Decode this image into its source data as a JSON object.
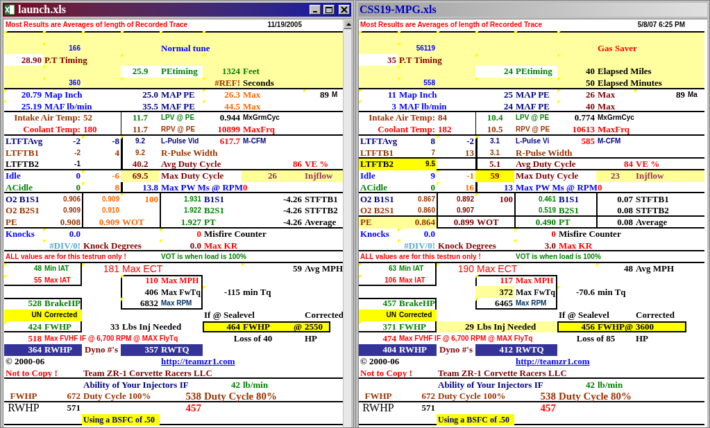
{
  "windows": [
    {
      "title": "launch.xls",
      "active": true,
      "cells": [
        {
          "text": "Most Results are Averages of length of Recorded Trace",
          "color": "#ff0000"
        },
        {
          "text": "11/19/2005",
          "color": "#000000"
        },
        {
          "text": "166",
          "color": "#0000ff"
        },
        {
          "text": "Normal tune",
          "color": "#0000ff"
        },
        {
          "text": "28.90",
          "color": "#800000"
        },
        {
          "text": "P.T Timing",
          "color": "#800000"
        },
        {
          "text": "25.9",
          "color": "#008000"
        },
        {
          "text": "PEtiming",
          "color": "#008000"
        },
        {
          "text": "1324",
          "color": "#008000"
        },
        {
          "text": "Feet",
          "color": "#008000"
        },
        {
          "text": "360",
          "color": "#0000ff"
        },
        {
          "text": "#REF!",
          "color": "#993300"
        },
        {
          "text": "Seconds",
          "color": "#000000"
        },
        {
          "text": "20.79",
          "color": "#0000ff"
        },
        {
          "text": "Map Inch",
          "color": "#0000ff"
        },
        {
          "text": "25.0",
          "color": "#000080"
        },
        {
          "text": "MAP PE",
          "color": "#000080"
        },
        {
          "text": "26.3",
          "color": "#ff6600"
        },
        {
          "text": "Max",
          "color": "#ff6600"
        },
        {
          "text": "89",
          "color": "#000000"
        },
        {
          "text": "M",
          "color": "#000000"
        },
        {
          "text": "25.19",
          "color": "#0000ff"
        },
        {
          "text": "MAF lb/min",
          "color": "#0000ff"
        },
        {
          "text": "35.5",
          "color": "#000080"
        },
        {
          "text": "MAF PE",
          "color": "#000080"
        },
        {
          "text": "44.5",
          "color": "#ff6600"
        },
        {
          "text": "Max",
          "color": "#ff6600"
        },
        {
          "text": "Intake Air Temp:",
          "color": "#993300"
        },
        {
          "text": "52",
          "color": "#993300"
        },
        {
          "text": "11.7",
          "color": "#008000"
        },
        {
          "text": "LPV @ PE",
          "color": "#008000"
        },
        {
          "text": "0.944",
          "color": "#000000"
        },
        {
          "text": "MxGrmCyc",
          "color": "#000000"
        },
        {
          "text": "Coolant Temp:",
          "color": "#ff0000"
        },
        {
          "text": "180",
          "color": "#ff0000"
        },
        {
          "text": "11.7",
          "color": "#993300"
        },
        {
          "text": "RPV @ PE",
          "color": "#993300"
        },
        {
          "text": "10899",
          "color": "#ff0000"
        },
        {
          "text": "MaxFrq",
          "color": "#ff0000"
        },
        {
          "text": "LTFTAvg",
          "color": "#000080"
        },
        {
          "text": "-2",
          "color": "#000080"
        },
        {
          "text": "-8",
          "color": "#000080"
        },
        {
          "text": "9.2",
          "color": "#000080"
        },
        {
          "text": "L-Pulse Vid",
          "color": "#000080"
        },
        {
          "text": "617.7",
          "color": "#ff0000"
        },
        {
          "text": "M-CFM",
          "color": "#000080"
        },
        {
          "text": "LTFTB1",
          "color": "#993300"
        },
        {
          "text": "-2",
          "color": "#993300"
        },
        {
          "text": "4",
          "color": "#993300"
        },
        {
          "text": "9.2",
          "color": "#993300"
        },
        {
          "text": "R-Pulse Width",
          "color": "#993300"
        },
        {
          "text": "LTFTB2",
          "color": "#000000"
        },
        {
          "text": "-1",
          "color": "#000000"
        },
        {
          "text": "40.2",
          "color": "#800000"
        },
        {
          "text": "Avg Duty Cycle",
          "color": "#800000"
        },
        {
          "text": "86",
          "color": "#ff0000"
        },
        {
          "text": "VE %",
          "color": "#ff0000"
        },
        {
          "text": "Idle",
          "color": "#0000ff"
        },
        {
          "text": "0",
          "color": "#0000ff"
        },
        {
          "text": "-6",
          "color": "#ff6600"
        },
        {
          "text": "69.5",
          "color": "#ffff99",
          "highlighted": true
        },
        {
          "text": "Max Duty Cycle",
          "color": "#800000"
        },
        {
          "text": "26",
          "color": "#ffff99",
          "highlighted": true
        },
        {
          "text": "Injflow",
          "color": "#ffff99",
          "highlighted": true
        },
        {
          "text": "ACidle",
          "color": "#008000"
        },
        {
          "text": "0",
          "color": "#008000"
        },
        {
          "text": "8",
          "color": "#ff6600"
        },
        {
          "text": "13.8",
          "color": "#0000ff"
        },
        {
          "text": "Max PW Ms @ RPM",
          "color": "#0000ff"
        },
        {
          "text": "0",
          "color": "#ff0000"
        },
        {
          "text": "O2 B1S1",
          "color": "#000080"
        },
        {
          "text": "0.906",
          "color": "#993300"
        },
        {
          "text": "0.909",
          "color": "#ff6600"
        },
        {
          "text": "100",
          "color": "#ff6600"
        },
        {
          "text": "1.931",
          "color": "#008000"
        },
        {
          "text": "B1S1",
          "color": "#000080"
        },
        {
          "text": "-4.26",
          "color": "#000000"
        },
        {
          "text": "STFTB1",
          "color": "#000000"
        },
        {
          "text": "O2 B2S1",
          "color": "#993300"
        },
        {
          "text": "0.909",
          "color": "#993300"
        },
        {
          "text": "0.910",
          "color": "#ff6600"
        },
        {
          "text": "1.922",
          "color": "#008000"
        },
        {
          "text": "B2S1",
          "color": "#008000"
        },
        {
          "text": "-4.26",
          "color": "#000000"
        },
        {
          "text": "STFTB2",
          "color": "#000000"
        },
        {
          "text": "PE",
          "color": "#993300"
        },
        {
          "text": "0.908",
          "color": "#993300"
        },
        {
          "text": "0.909",
          "color": "#ff6600"
        },
        {
          "text": "WOT",
          "color": "#ff6600"
        },
        {
          "text": "1.927",
          "color": "#008000"
        },
        {
          "text": "PT",
          "color": "#008000"
        },
        {
          "text": "-4.26",
          "color": "#000000"
        },
        {
          "text": "Average",
          "color": "#000000"
        },
        {
          "text": "Knocks",
          "color": "#0000ff"
        },
        {
          "text": "0.0",
          "color": "#0000ff"
        },
        {
          "text": "0",
          "color": "#ff0000"
        },
        {
          "text": "Misfire Counter",
          "color": "#000000"
        },
        {
          "text": "#DIV/0!",
          "color": "#5aa9cc"
        },
        {
          "text": "Knock  Degrees",
          "color": "#800000"
        },
        {
          "text": "0.0",
          "color": "#800000"
        },
        {
          "text": "Max KR",
          "color": "#ff0000"
        },
        {
          "text": "ALL values are for this testrun only !",
          "color": "#ff0000"
        },
        {
          "text": "VOT is when load is 100%",
          "color": "#008000"
        },
        {
          "text": "48",
          "color": "#008000"
        },
        {
          "text": "Min IAT",
          "color": "#008000"
        },
        {
          "text": "181",
          "color": "#ff0000"
        },
        {
          "text": "Max ECT",
          "color": "#ff0000"
        },
        {
          "text": "59",
          "color": "#000000"
        },
        {
          "text": "Avg MPH",
          "color": "#000000"
        },
        {
          "text": "55",
          "color": "#ff0000"
        },
        {
          "text": "Max IAT",
          "color": "#ff0000"
        },
        {
          "text": "110",
          "color": "#ff0000"
        },
        {
          "text": "Max MPH",
          "color": "#ff0000"
        },
        {
          "text": "406",
          "color": "#000000"
        },
        {
          "text": "Max FwTq",
          "color": "#000000"
        },
        {
          "text": "-115",
          "color": "#000000"
        },
        {
          "text": "min Tq",
          "color": "#000000"
        },
        {
          "text": "528",
          "color": "#008000"
        },
        {
          "text": "BrakeHP",
          "color": "#008000"
        },
        {
          "text": "6832",
          "color": "#000000"
        },
        {
          "text": "Max RPM",
          "color": "#003366"
        },
        {
          "text": "UN",
          "color": "#ffff00",
          "highlighted": true
        },
        {
          "text": "Corrected",
          "color": "#ffff00",
          "highlighted": true
        },
        {
          "text": "If @ Sealevel",
          "color": "#000000"
        },
        {
          "text": "Corrected",
          "color": "#000000"
        },
        {
          "text": "424",
          "color": "#008000"
        },
        {
          "text": "FWHP",
          "color": "#008000"
        },
        {
          "text": "33",
          "color": "#000000"
        },
        {
          "text": "Lbs Inj Needed",
          "color": "#000000"
        },
        {
          "text": "464",
          "color": "#000000"
        },
        {
          "text": "FWHP",
          "color": "#000000"
        },
        {
          "text": "@",
          "color": "#000000"
        },
        {
          "text": "2550",
          "color": "#000000"
        },
        {
          "text": "518",
          "color": "#ff0000"
        },
        {
          "text": "Max FVHF IF @ 6,700 RPM @ MAX FlyTq",
          "color": "#ff0000"
        },
        {
          "text": "Loss of 40",
          "color": "#000000"
        },
        {
          "text": "HP",
          "color": "#000000"
        },
        {
          "text": "364",
          "color": "#333399",
          "highlighted": true
        },
        {
          "text": "RWHP",
          "color": "#333399",
          "highlighted": true
        },
        {
          "text": "Dyno #'s",
          "color": "#800000"
        },
        {
          "text": "357",
          "color": "#333399",
          "highlighted": true
        },
        {
          "text": "RWTQ",
          "color": "#333399",
          "highlighted": true
        },
        {
          "text": "© 2000-06",
          "color": "#000000"
        },
        {
          "text": "http://teamzr1.com",
          "color": "#0000ff"
        },
        {
          "text": "Not to Copy !",
          "color": "#ff0000"
        },
        {
          "text": "Team ZR-1 Corvette Racers LLC",
          "color": "#800000"
        },
        {
          "text": "Ability of Your Injectors IF",
          "color": "#000080"
        },
        {
          "text": "42",
          "color": "#008000"
        },
        {
          "text": "lb/min",
          "color": "#008000"
        },
        {
          "text": "FWHP",
          "color": "#993300"
        },
        {
          "text": "672",
          "color": "#993300"
        },
        {
          "text": "Duty Cycle 100%",
          "color": "#993300"
        },
        {
          "text": "538",
          "color": "#993300"
        },
        {
          "text": "Duty Cycle 80%",
          "color": "#993300"
        },
        {
          "text": "RWHP",
          "color": "#000000"
        },
        {
          "text": "571",
          "color": "#000000"
        },
        {
          "text": "457",
          "color": "#ff0000"
        },
        {
          "text": "Using a BSFC of .50",
          "color": "#ffff00",
          "highlighted": true
        }
      ]
    },
    {
      "title": "CSS19-MPG.xls",
      "active": false,
      "cells": [
        {
          "text": "Most Results are Averages of length of Recorded Trace",
          "color": "#ff0000"
        },
        {
          "text": "5/8/07 6:25 PM",
          "color": "#000000"
        },
        {
          "text": "56119",
          "color": "#0000ff"
        },
        {
          "text": "Gas Saver",
          "color": "#ff0000"
        },
        {
          "text": "35",
          "color": "#800000"
        },
        {
          "text": "P.T Timing",
          "color": "#800000"
        },
        {
          "text": "24",
          "color": "#008000"
        },
        {
          "text": "PEtiming",
          "color": "#008000"
        },
        {
          "text": "40",
          "color": "#000000"
        },
        {
          "text": "Elapsed Miles",
          "color": "#000000"
        },
        {
          "text": "558",
          "color": "#0000ff"
        },
        {
          "text": "50",
          "color": "#000000"
        },
        {
          "text": "Elapsed Minutes",
          "color": "#000000"
        },
        {
          "text": "11",
          "color": "#0000ff"
        },
        {
          "text": "Map Inch",
          "color": "#0000ff"
        },
        {
          "text": "25",
          "color": "#000080"
        },
        {
          "text": "MAP PE",
          "color": "#000080"
        },
        {
          "text": "26",
          "color": "#800000"
        },
        {
          "text": "Max",
          "color": "#800000"
        },
        {
          "text": "89",
          "color": "#000000"
        },
        {
          "text": "Ma",
          "color": "#000000"
        },
        {
          "text": "3",
          "color": "#0000ff"
        },
        {
          "text": "MAF lb/min",
          "color": "#0000ff"
        },
        {
          "text": "24",
          "color": "#000080"
        },
        {
          "text": "MAF PE",
          "color": "#000080"
        },
        {
          "text": "40",
          "color": "#800000"
        },
        {
          "text": "Max",
          "color": "#800000"
        },
        {
          "text": "Intake Air Temp:",
          "color": "#993300"
        },
        {
          "text": "84",
          "color": "#993300"
        },
        {
          "text": "10.4",
          "color": "#008000"
        },
        {
          "text": "LPV @ PE",
          "color": "#008000"
        },
        {
          "text": "0.774",
          "color": "#000000"
        },
        {
          "text": "MxGrmCyc",
          "color": "#000000"
        },
        {
          "text": "Coolant Temp:",
          "color": "#ff0000"
        },
        {
          "text": "182",
          "color": "#ff0000"
        },
        {
          "text": "10.5",
          "color": "#993300"
        },
        {
          "text": "RPV @ PE",
          "color": "#993300"
        },
        {
          "text": "10613",
          "color": "#ff0000"
        },
        {
          "text": "MaxFrq",
          "color": "#ff0000"
        },
        {
          "text": "LTFTAvg",
          "color": "#000080"
        },
        {
          "text": "8",
          "color": "#000080"
        },
        {
          "text": "-2",
          "color": "#000080"
        },
        {
          "text": "3.1",
          "color": "#000080"
        },
        {
          "text": "L-Pulse Vi",
          "color": "#000080"
        },
        {
          "text": "585",
          "color": "#ff0000"
        },
        {
          "text": "M-CFM",
          "color": "#000080"
        },
        {
          "text": "LTFTB1",
          "color": "#993300"
        },
        {
          "text": "7",
          "color": "#993300"
        },
        {
          "text": "13",
          "color": "#993300"
        },
        {
          "text": "3.1",
          "color": "#993300"
        },
        {
          "text": "R-Pulse Width",
          "color": "#993300"
        },
        {
          "text": "LTFTB2",
          "color": "#ffff00",
          "highlighted": true
        },
        {
          "text": "9.5",
          "color": "#ffff00",
          "highlighted": true
        },
        {
          "text": "5.1",
          "color": "#800000"
        },
        {
          "text": "Avg Duty Cycle",
          "color": "#800000"
        },
        {
          "text": "84",
          "color": "#ff0000"
        },
        {
          "text": "VE %",
          "color": "#ff0000"
        },
        {
          "text": "Idle",
          "color": "#0000ff"
        },
        {
          "text": "9",
          "color": "#0000ff"
        },
        {
          "text": "-1",
          "color": "#ff6600"
        },
        {
          "text": "59",
          "color": "#ffff00",
          "highlighted": true
        },
        {
          "text": "Max Duty Cycle",
          "color": "#800000"
        },
        {
          "text": "23",
          "color": "#ffff99",
          "highlighted": true
        },
        {
          "text": "Injflow",
          "color": "#ffff99",
          "highlighted": true
        },
        {
          "text": "ACidle",
          "color": "#008000"
        },
        {
          "text": "0",
          "color": "#008000"
        },
        {
          "text": "16",
          "color": "#ff6600"
        },
        {
          "text": "13",
          "color": "#0000ff"
        },
        {
          "text": "Max PW Ms @ RPM",
          "color": "#0000ff"
        },
        {
          "text": "0",
          "color": "#ff0000"
        },
        {
          "text": "O2 B1S1",
          "color": "#000080"
        },
        {
          "text": "0.867",
          "color": "#993300"
        },
        {
          "text": "0.892",
          "color": "#800000"
        },
        {
          "text": "100",
          "color": "#800000"
        },
        {
          "text": "0.461",
          "color": "#008000"
        },
        {
          "text": "B1S1",
          "color": "#000080"
        },
        {
          "text": "0.07",
          "color": "#000000"
        },
        {
          "text": "STFTB1",
          "color": "#000000"
        },
        {
          "text": "O2 B2S1",
          "color": "#993300"
        },
        {
          "text": "0.860",
          "color": "#993300"
        },
        {
          "text": "0.907",
          "color": "#800000"
        },
        {
          "text": "0.519",
          "color": "#008000"
        },
        {
          "text": "B2S1",
          "color": "#008000"
        },
        {
          "text": "0.08",
          "color": "#000000"
        },
        {
          "text": "STFTB2",
          "color": "#000000"
        },
        {
          "text": "PE",
          "color": "#ffff99",
          "highlighted": true
        },
        {
          "text": "0.864",
          "color": "#ffff99",
          "highlighted": true
        },
        {
          "text": "0.899",
          "color": "#800000"
        },
        {
          "text": "WOT",
          "color": "#800000"
        },
        {
          "text": "0.490",
          "color": "#008000"
        },
        {
          "text": "PT",
          "color": "#008000"
        },
        {
          "text": "0.08",
          "color": "#000000"
        },
        {
          "text": "Average",
          "color": "#000000"
        },
        {
          "text": "Knocks",
          "color": "#0000ff"
        },
        {
          "text": "0.0",
          "color": "#0000ff"
        },
        {
          "text": "0",
          "color": "#ff0000"
        },
        {
          "text": "Misfire Counter",
          "color": "#000000"
        },
        {
          "text": "#DIV/0!",
          "color": "#5aa9cc"
        },
        {
          "text": "Knock  Degrees",
          "color": "#800000"
        },
        {
          "text": "3.0",
          "color": "#800000"
        },
        {
          "text": "Max KR",
          "color": "#ff0000"
        },
        {
          "text": "ALL values are for this testrun only !",
          "color": "#ff0000"
        },
        {
          "text": "VOT is when load is 100%",
          "color": "#008000"
        },
        {
          "text": "63",
          "color": "#008000"
        },
        {
          "text": "Min IAT",
          "color": "#008000"
        },
        {
          "text": "190",
          "color": "#ff0000"
        },
        {
          "text": "Max ECT",
          "color": "#ff0000"
        },
        {
          "text": "48",
          "color": "#000000"
        },
        {
          "text": "Avg MPH",
          "color": "#000000"
        },
        {
          "text": "106",
          "color": "#ff0000"
        },
        {
          "text": "Max IAT",
          "color": "#ff0000"
        },
        {
          "text": "117",
          "color": "#ff0000"
        },
        {
          "text": "Max MPH",
          "color": "#ff0000"
        },
        {
          "text": "372",
          "color": "#ffff99",
          "highlighted": true
        },
        {
          "text": "Max FwTq",
          "color": "#000000"
        },
        {
          "text": "-70.6",
          "color": "#000000"
        },
        {
          "text": "min Tq",
          "color": "#000000"
        },
        {
          "text": "457",
          "color": "#008000"
        },
        {
          "text": "BrakeHP",
          "color": "#008000"
        },
        {
          "text": "6465",
          "color": "#000000"
        },
        {
          "text": "Max RPM",
          "color": "#003366"
        },
        {
          "text": "UN",
          "color": "#ffff00",
          "highlighted": true
        },
        {
          "text": "Corrected",
          "color": "#ffff00",
          "highlighted": true
        },
        {
          "text": "If @ Sealevel",
          "color": "#000000"
        },
        {
          "text": "Corrected",
          "color": "#000000"
        },
        {
          "text": "371",
          "color": "#008000"
        },
        {
          "text": "FWHP",
          "color": "#008000"
        },
        {
          "text": "29",
          "color": "#ffff99",
          "highlighted": true
        },
        {
          "text": "Lbs Inj Needed",
          "color": "#ffff99",
          "highlighted": true
        },
        {
          "text": "456",
          "color": "#000000"
        },
        {
          "text": "FWHP",
          "color": "#000000"
        },
        {
          "text": "@",
          "color": "#000000"
        },
        {
          "text": "3600",
          "color": "#000000"
        },
        {
          "text": "474",
          "color": "#ff0000"
        },
        {
          "text": "Max FVHF IF @ 6,700 RPM @ MAX FlyTq",
          "color": "#ff0000"
        },
        {
          "text": "Loss of 85",
          "color": "#000000"
        },
        {
          "text": "HP",
          "color": "#000000"
        },
        {
          "text": "404",
          "color": "#333399",
          "highlighted": true
        },
        {
          "text": "RWHP",
          "color": "#333399",
          "highlighted": true
        },
        {
          "text": "Dyno #'s",
          "color": "#800000"
        },
        {
          "text": "412",
          "color": "#333399",
          "highlighted": true
        },
        {
          "text": "RWTQ",
          "color": "#333399",
          "highlighted": true
        },
        {
          "text": "© 2000-06",
          "color": "#000000"
        },
        {
          "text": "http://teamzr1.com",
          "color": "#0000ff"
        },
        {
          "text": "Not to Copy !",
          "color": "#ff0000"
        },
        {
          "text": "Team ZR-1 Corvette Racers LLC",
          "color": "#800000"
        },
        {
          "text": "Ability of Your Injectors IF",
          "color": "#000080"
        },
        {
          "text": "42",
          "color": "#008000"
        },
        {
          "text": "lb/min",
          "color": "#008000"
        },
        {
          "text": "FWHP",
          "color": "#993300"
        },
        {
          "text": "672",
          "color": "#993300"
        },
        {
          "text": "Duty Cycle 100%",
          "color": "#993300"
        },
        {
          "text": "538",
          "color": "#993300"
        },
        {
          "text": "Duty Cycle 80%",
          "color": "#993300"
        },
        {
          "text": "RWHP",
          "color": "#000000"
        },
        {
          "text": "571",
          "color": "#000000"
        },
        {
          "text": "457",
          "color": "#ff0000"
        },
        {
          "text": "Using a BSFC of .50",
          "color": "#ffff00",
          "highlighted": true
        }
      ]
    }
  ]
}
